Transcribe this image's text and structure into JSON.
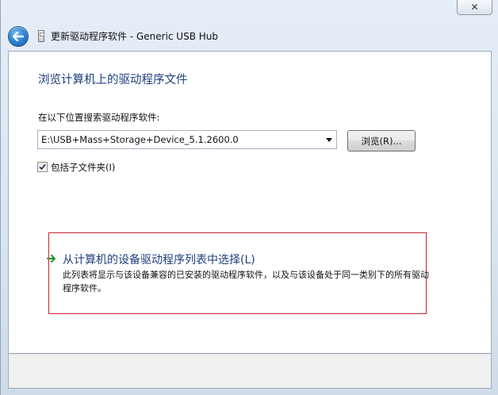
{
  "window": {
    "close_glyph": "✕",
    "title": "更新驱动程序软件 - Generic USB Hub"
  },
  "nav": {
    "back_icon": "back-arrow-icon",
    "device_icon": "usb-device-icon"
  },
  "main": {
    "heading": "浏览计算机上的驱动程序文件",
    "search_label": "在以下位置搜索驱动程序软件:",
    "path_value": "E:\\USB+Mass+Storage+Device_5.1.2600.0",
    "browse_label": "浏览(R)...",
    "include_subfolders_label": "包括子文件夹(I)",
    "include_subfolders_checked": true
  },
  "option": {
    "title": "从计算机的设备驱动程序列表中选择(L)",
    "description": "此列表将显示与该设备兼容的已安装的驱动程序软件，以及与该设备处于同一类别下的所有驱动程序软件。",
    "arrow_color": "#2e9a2e",
    "highlight_color": "#c6252e"
  },
  "colors": {
    "heading": "#1f3f7d",
    "frame": "#dce7f2"
  }
}
